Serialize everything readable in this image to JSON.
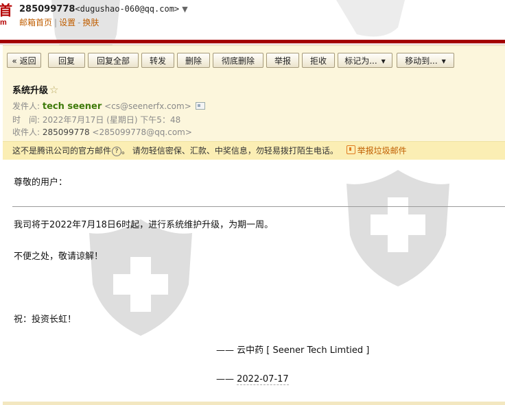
{
  "header": {
    "logo_text": "首",
    "logo_subtext": "m",
    "account_number": "285099778",
    "account_email": "<dugushao-060@qq.com>",
    "account_dropdown": "▼",
    "links": [
      "邮箱首页",
      "设置",
      "换肤"
    ],
    "link_separators": [
      "|",
      "-"
    ]
  },
  "toolbar": {
    "back": "« 返回",
    "reply": "回复",
    "reply_all": "回复全部",
    "forward": "转发",
    "delete": "删除",
    "delete_permanent": "彻底删除",
    "report": "举报",
    "reject": "拒收",
    "mark_as": "标记为...",
    "move_to": "移动到...",
    "dropdown_glyph": "▼"
  },
  "message": {
    "subject": "系统升级",
    "star_glyph": "☆",
    "from_label": "发件人:",
    "from_name": "tech seener",
    "from_email": "<cs@seenerfx.com>",
    "time_label": "时　间:",
    "time_value": "2022年7月17日 (星期日) 下午5：48",
    "to_label": "收件人:",
    "to_name": "285099778",
    "to_email": "<285099778@qq.com>"
  },
  "warning": {
    "text1": "这不是腾讯公司的官方邮件",
    "q_glyph": "?",
    "text2": "。 请勿轻信密保、汇款、中奖信息，勿轻易拨打陌生电话。",
    "report_link": "举报垃圾邮件"
  },
  "body": {
    "greeting": "尊敬的用户：",
    "line1": "我司将于2022年7月18日6时起，进行系统维护升级，为期一周。",
    "line2": "不便之处，敬请谅解！",
    "line3": "祝：投资长虹！",
    "sig_prefix": "—— ",
    "sig_company": "云中药 [ Seener Tech Limtied ]",
    "date_prefix": "——  ",
    "date": "2022-07-17"
  },
  "colors": {
    "brand_red": "#a30000",
    "sender_green": "#3e7a0a",
    "link_orange": "#c05e00",
    "panel_bg": "#fcf6dc",
    "warning_bg": "#fbeeb4"
  }
}
